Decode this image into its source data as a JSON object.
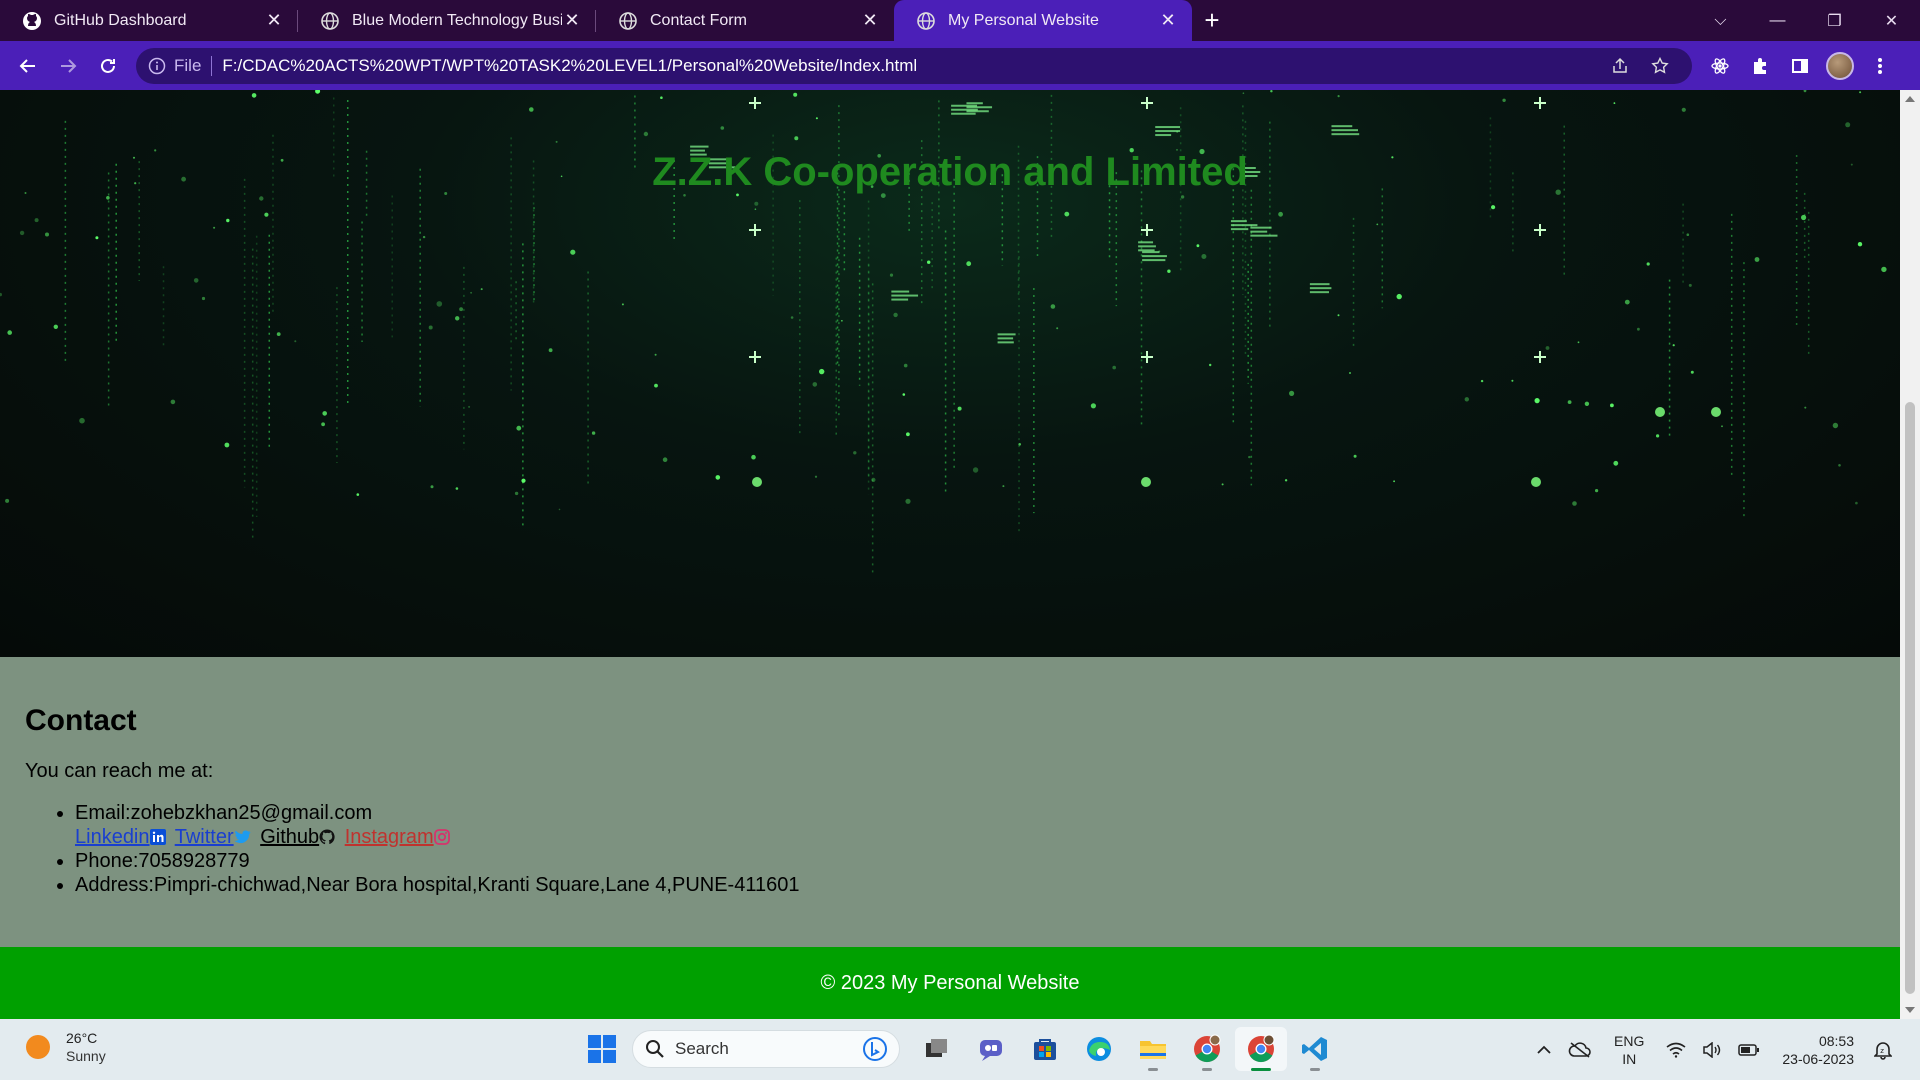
{
  "browser": {
    "tabs": [
      {
        "title": "GitHub Dashboard",
        "active": false,
        "favicon": "github-icon"
      },
      {
        "title": "Blue Modern Technology Busines",
        "active": false,
        "favicon": "globe-icon"
      },
      {
        "title": "Contact Form",
        "active": false,
        "favicon": "globe-icon"
      },
      {
        "title": "My Personal Website",
        "active": true,
        "favicon": "globe-icon"
      }
    ],
    "new_tab_label": "+",
    "address": {
      "scheme_label": "File",
      "url": "F:/CDAC%20ACTS%20WPT/WPT%20TASK2%20LEVEL1/Personal%20Website/Index.html"
    },
    "colors": {
      "tabstrip": "#2a0a3a",
      "active_tab": "#4b1fb8",
      "toolbar": "#4b1fb8"
    }
  },
  "page": {
    "hero_title": "Z.Z.K Co-operation and Limited",
    "contact": {
      "heading": "Contact",
      "intro": "You can reach me at:",
      "email": "Email:zohebzkhan25@gmail.com",
      "links": [
        {
          "label": "Linkedin",
          "icon": "linkedin-icon"
        },
        {
          "label": "Twitter",
          "icon": "twitter-icon"
        },
        {
          "label": "Github",
          "icon": "github-icon"
        },
        {
          "label": "Instagram",
          "icon": "instagram-icon"
        }
      ],
      "phone": "Phone:7058928779",
      "address": "Address:Pimpri-chichwad,Near Bora hospital,Kranti Square,Lane 4,PUNE-411601"
    },
    "footer": "© 2023 My Personal Website",
    "colors": {
      "hero_title": "#1f8a1f",
      "contact_bg": "#7d9280",
      "footer_bg": "#00a000"
    }
  },
  "taskbar": {
    "weather": {
      "temp": "26°C",
      "condition": "Sunny"
    },
    "search_placeholder": "Search",
    "apps": [
      "task-view-icon",
      "teams-chat-icon",
      "store-icon",
      "edge-icon",
      "file-explorer-icon",
      "chrome-icon",
      "chrome-icon",
      "vscode-icon"
    ],
    "tray": {
      "lang_top": "ENG",
      "lang_bottom": "IN",
      "time": "08:53",
      "date": "23-06-2023"
    }
  }
}
